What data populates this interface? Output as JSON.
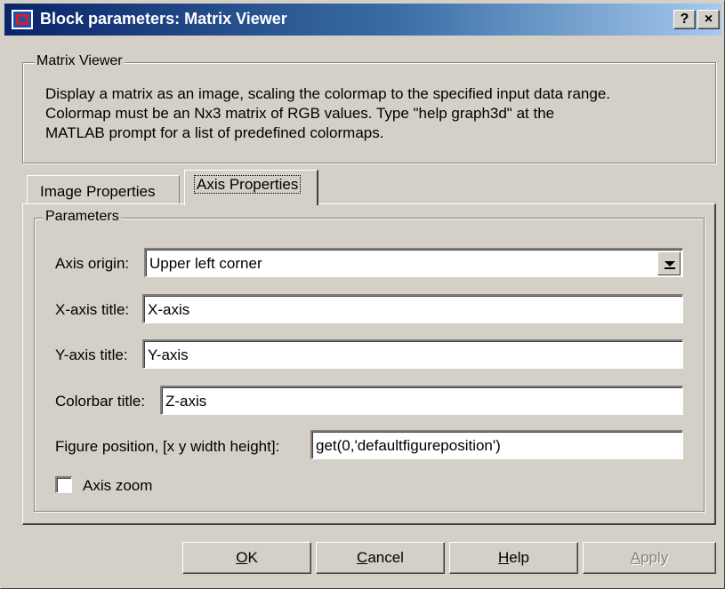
{
  "window": {
    "title": "Block parameters: Matrix Viewer",
    "help_button": "?",
    "close_button": "×"
  },
  "description": {
    "group_label": "Matrix Viewer",
    "lines": [
      "Display a matrix as an image, scaling the colormap to the specified input data range.",
      "Colormap must be an Nx3 matrix of RGB values.  Type \"help graph3d\" at the",
      "MATLAB prompt for a list of predefined colormaps."
    ]
  },
  "tabs": [
    {
      "label": "Image Properties",
      "active": false
    },
    {
      "label": "Axis Properties",
      "active": true
    }
  ],
  "parameters": {
    "group_label": "Parameters",
    "axis_origin": {
      "label": "Axis origin:",
      "value": "Upper left corner"
    },
    "x_axis_title": {
      "label": "X-axis title:",
      "value": "X-axis"
    },
    "y_axis_title": {
      "label": "Y-axis title:",
      "value": "Y-axis"
    },
    "colorbar_title": {
      "label": "Colorbar title:",
      "value": "Z-axis"
    },
    "figure_position": {
      "label": "Figure position, [x y width height]:",
      "value": "get(0,'defaultfigureposition')"
    },
    "axis_zoom": {
      "label": "Axis zoom",
      "checked": false
    }
  },
  "buttons": {
    "ok": {
      "mnemonic": "O",
      "rest": "K"
    },
    "cancel": {
      "mnemonic": "C",
      "rest": "ancel"
    },
    "help": {
      "mnemonic": "H",
      "rest": "elp"
    },
    "apply": {
      "mnemonic": "A",
      "rest": "pply",
      "disabled": true
    }
  },
  "colors": {
    "face": "#d4d0c8",
    "title_start": "#0a246a",
    "title_end": "#a6caf0"
  }
}
